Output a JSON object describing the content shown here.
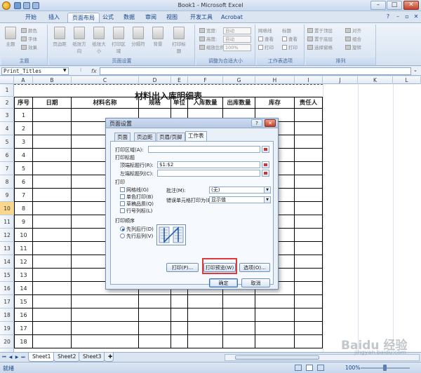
{
  "window": {
    "title": "Book1 - Microsoft Excel",
    "min": "–",
    "max": "□",
    "close": "✕"
  },
  "ribbon_tabs": [
    "开始",
    "插入",
    "页面布局",
    "公式",
    "数据",
    "审阅",
    "视图",
    "开发工具",
    "Acrobat"
  ],
  "ribbon_groups": {
    "theme": {
      "label": "主题",
      "theme_btn": "主题",
      "colors": "颜色",
      "fonts": "字体",
      "effects": "效果"
    },
    "page_setup": {
      "label": "页面设置",
      "buttons": [
        "页边距",
        "纸张方向",
        "纸张大小",
        "打印区域",
        "分隔符",
        "背景",
        "打印标题"
      ]
    },
    "scale": {
      "label": "调整为合适大小",
      "width": "宽度:",
      "height": "高度:",
      "scale": "缩放比例:",
      "auto1": "自动",
      "auto2": "自动",
      "pct": "100%"
    },
    "sheet_options": {
      "label": "工作表选项",
      "gridlines": "网格线",
      "headings": "标题",
      "view1": "查看",
      "view2": "查看",
      "print1": "打印",
      "print2": "打印"
    },
    "arrange": {
      "label": "排列",
      "front": "置于顶层",
      "back": "置于底层",
      "pane": "选择窗格",
      "align": "对齐",
      "group": "组合",
      "rotate": "旋转"
    }
  },
  "formula_bar": {
    "name_box": "Print_Titles",
    "fx": "fx"
  },
  "columns": [
    "A",
    "B",
    "C",
    "D",
    "E",
    "F",
    "G",
    "H",
    "I",
    "J",
    "K",
    "L"
  ],
  "rows": [
    "1",
    "2",
    "3",
    "4",
    "5",
    "6",
    "7",
    "8",
    "9",
    "10",
    "11",
    "12",
    "13",
    "14",
    "15",
    "16",
    "17",
    "18",
    "19",
    "20"
  ],
  "sheet": {
    "title": "材料出入库明细表",
    "headers": [
      "序号",
      "日期",
      "材料名称",
      "规格",
      "单位",
      "入库数量",
      "出库数量",
      "库存",
      "责任人"
    ],
    "row_numbers": [
      "1",
      "2",
      "3",
      "4",
      "5",
      "6",
      "7",
      "8",
      "9",
      "10",
      "11",
      "12",
      "13",
      "14",
      "15",
      "16",
      "17",
      "18"
    ]
  },
  "sheet_tabs": [
    "Sheet1",
    "Sheet2",
    "Sheet3"
  ],
  "status": {
    "text": "就绪",
    "zoom": "100%"
  },
  "dialog": {
    "title": "页面设置",
    "help": "?",
    "close": "✕",
    "tabs": [
      "页面",
      "页边距",
      "页眉/页脚",
      "工作表"
    ],
    "print_area_label": "打印区域(A):",
    "print_titles_label": "打印标题",
    "top_rows_label": "顶端标题行(R):",
    "top_rows_value": "$1:$2",
    "left_cols_label": "左端标题列(C):",
    "print_label": "打印",
    "gridlines": "网格线(G)",
    "bw": "单色打印(B)",
    "draft": "草稿品质(Q)",
    "row_col_headings": "行号列标(L)",
    "comments_label": "批注(M):",
    "comments_value": "(无)",
    "errors_label": "错误单元格打印为(E):",
    "errors_value": "显示值",
    "order_label": "打印顺序",
    "down_then_over": "先列后行(D)",
    "over_then_down": "先行后列(V)",
    "btn_print": "打印(P)...",
    "btn_preview": "打印预览(W)",
    "btn_options": "选项(O)...",
    "btn_ok": "确定",
    "btn_cancel": "取消"
  },
  "watermark": {
    "brand": "Baidu 经验",
    "url": "jingyan.baidu.com"
  },
  "colors": {
    "highlight": "#e03a3a",
    "accent": "#15428b"
  }
}
